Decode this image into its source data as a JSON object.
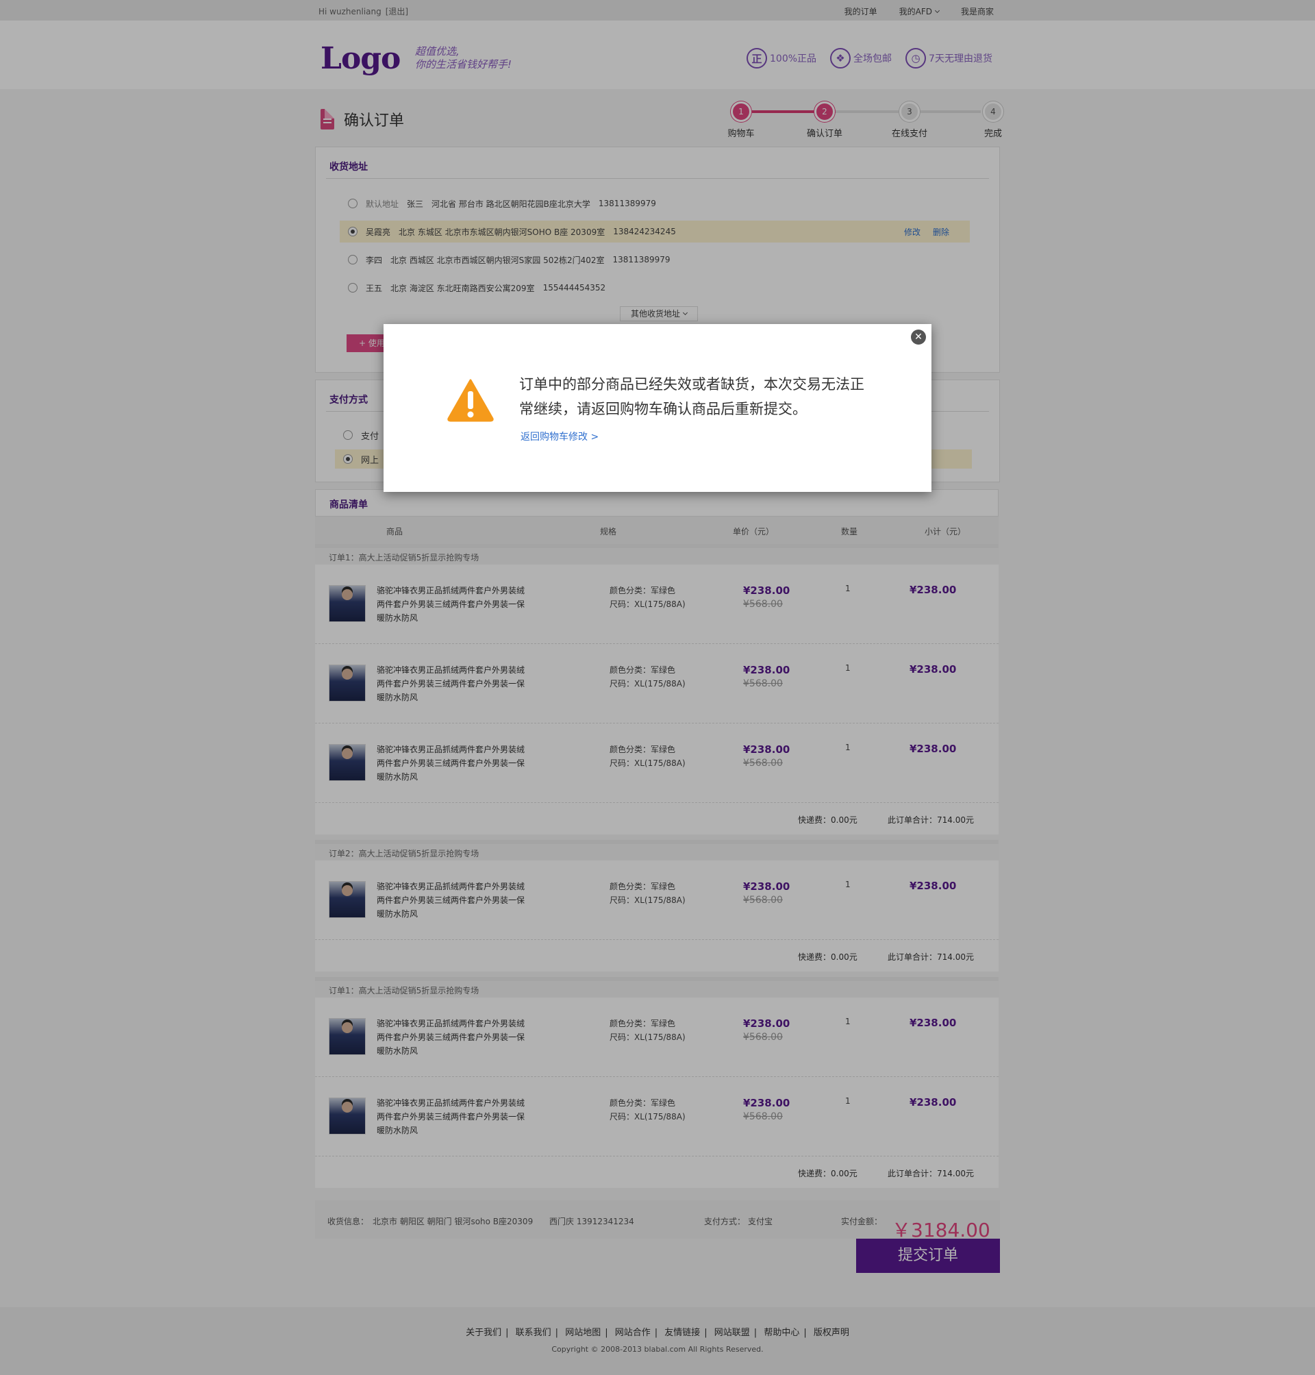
{
  "topbar": {
    "greeting": "Hi wuzhenliang",
    "logout": "[退出]",
    "links": [
      "我的订单",
      "我的AFD",
      "我是商家"
    ]
  },
  "header": {
    "logo": "Logo",
    "slogan_line1": "超值优选,",
    "slogan_line2": "你的生活省钱好帮手!",
    "badges": [
      {
        "icon": "genuine-icon",
        "glyph": "正",
        "label": "100%正品"
      },
      {
        "icon": "free-shipping-icon",
        "glyph": "❖",
        "label": "全场包邮"
      },
      {
        "icon": "return-clock-icon",
        "glyph": "◷",
        "label": "7天无理由退货"
      }
    ]
  },
  "page": {
    "title": "确认订单"
  },
  "steps": [
    {
      "num": "1",
      "label": "购物车"
    },
    {
      "num": "2",
      "label": "确认订单"
    },
    {
      "num": "3",
      "label": "在线支付"
    },
    {
      "num": "4",
      "label": "完成"
    }
  ],
  "address": {
    "title": "收货地址",
    "items": [
      {
        "prefix": "默认地址",
        "name": "张三",
        "detail": "河北省 邢台市 路北区朝阳花园B座北京大学",
        "phone": "13811389979"
      },
      {
        "prefix": "",
        "name": "吴霞亮",
        "detail": "北京 东城区 北京市东城区朝内银河SOHO B座 20309室",
        "phone": "138424234245",
        "edit": "修改",
        "delete": "删除"
      },
      {
        "prefix": "",
        "name": "李四",
        "detail": "北京 西城区 北京市西城区朝内银河S家园 502栋2门402室",
        "phone": "13811389979"
      },
      {
        "prefix": "",
        "name": "王五",
        "detail": "北京 海淀区 东北旺南路西安公寓209室",
        "phone": "155444454352"
      }
    ],
    "other_button": "其他收货地址",
    "use_button": "+ 使用"
  },
  "payment": {
    "title": "支付方式",
    "options": [
      "支付",
      "网上"
    ]
  },
  "goods": {
    "title": "商品清单",
    "columns": [
      "商品",
      "规格",
      "单价（元）",
      "数量",
      "小计（元）"
    ]
  },
  "orders": [
    {
      "head": "订单1：高大上活动促销5折显示抢购专场",
      "items": [
        {
          "name": "骆驼冲锋衣男正品抓绒两件套户外男装绒两件套户外男装三绒两件套户外男装一保暖防水防风",
          "color": "颜色分类：军绿色",
          "size": "尺码：XL(175/88A)",
          "price": "¥238.00",
          "old": "¥568.00",
          "qty": "1",
          "subtotal": "¥238.00"
        },
        {
          "name": "骆驼冲锋衣男正品抓绒两件套户外男装绒两件套户外男装三绒两件套户外男装一保暖防水防风",
          "color": "颜色分类：军绿色",
          "size": "尺码：XL(175/88A)",
          "price": "¥238.00",
          "old": "¥568.00",
          "qty": "1",
          "subtotal": "¥238.00"
        },
        {
          "name": "骆驼冲锋衣男正品抓绒两件套户外男装绒两件套户外男装三绒两件套户外男装一保暖防水防风",
          "color": "颜色分类：军绿色",
          "size": "尺码：XL(175/88A)",
          "price": "¥238.00",
          "old": "¥568.00",
          "qty": "1",
          "subtotal": "¥238.00"
        }
      ],
      "shipping": "快递费：0.00元",
      "total": "此订单合计：714.00元"
    },
    {
      "head": "订单2：高大上活动促销5折显示抢购专场",
      "items": [
        {
          "name": "骆驼冲锋衣男正品抓绒两件套户外男装绒两件套户外男装三绒两件套户外男装一保暖防水防风",
          "color": "颜色分类：军绿色",
          "size": "尺码：XL(175/88A)",
          "price": "¥238.00",
          "old": "¥568.00",
          "qty": "1",
          "subtotal": "¥238.00"
        }
      ],
      "shipping": "快递费：0.00元",
      "total": "此订单合计：714.00元"
    },
    {
      "head": "订单1：高大上活动促销5折显示抢购专场",
      "items": [
        {
          "name": "骆驼冲锋衣男正品抓绒两件套户外男装绒两件套户外男装三绒两件套户外男装一保暖防水防风",
          "color": "颜色分类：军绿色",
          "size": "尺码：XL(175/88A)",
          "price": "¥238.00",
          "old": "¥568.00",
          "qty": "1",
          "subtotal": "¥238.00"
        },
        {
          "name": "骆驼冲锋衣男正品抓绒两件套户外男装绒两件套户外男装三绒两件套户外男装一保暖防水防风",
          "color": "颜色分类：军绿色",
          "size": "尺码：XL(175/88A)",
          "price": "¥238.00",
          "old": "¥568.00",
          "qty": "1",
          "subtotal": "¥238.00"
        }
      ],
      "shipping": "快递费：0.00元",
      "total": "此订单合计：714.00元"
    }
  ],
  "summary": {
    "ship_label": "收货信息：",
    "ship_value": "北京市 朝阳区 朝阳门 银河soho B座20309",
    "receiver": "西门庆 13912341234",
    "pay_label": "支付方式：",
    "pay_value": "支付宝",
    "amount_label": "实付金额：",
    "amount": "￥3184.00",
    "submit": "提交订单"
  },
  "footer": {
    "links": [
      "关于我们",
      "联系我们",
      "网站地图",
      "网站合作",
      "友情链接",
      "网站联盟",
      "帮助中心",
      "版权声明"
    ],
    "copyright": "Copyright © 2008-2013 blabal.com All Rights Reserved."
  },
  "modal": {
    "message": "订单中的部分商品已经失效或者缺货，本次交易无法正常继续，请返回购物车确认商品后重新提交。",
    "link": "返回购物车修改 >",
    "close": "✕"
  },
  "colors": {
    "brand": "#5a1a92",
    "accent": "#e0457f",
    "link": "#2f6fce",
    "warning": "#f59a1b"
  }
}
